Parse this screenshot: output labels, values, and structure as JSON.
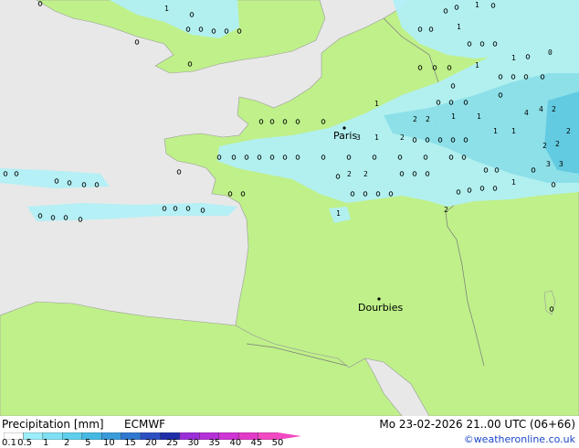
{
  "legend": {
    "title": "Precipitation [mm]",
    "model": "ECMWF",
    "ticks": [
      "0.1",
      "0.5",
      "1",
      "2",
      "5",
      "10",
      "15",
      "20",
      "25",
      "30",
      "35",
      "40",
      "45",
      "50"
    ],
    "colors": [
      "#ffffff",
      "#9beefa",
      "#7fe0f4",
      "#5ecfec",
      "#46b9e3",
      "#3a9bd9",
      "#2f78cf",
      "#2d4fc4",
      "#1f2ea8",
      "#9b2fd8",
      "#b530d8",
      "#cf34d4",
      "#e33ac8",
      "#f24ac2"
    ]
  },
  "datetime": "Mo 23-02-2026 21..00 UTC (06+66)",
  "credit": "©weatheronline.co.uk",
  "cities": [
    {
      "name": "Paris"
    },
    {
      "name": "Dourbies"
    }
  ],
  "map_colors": {
    "sea": "#e8e8e8",
    "land": "#bff08a",
    "precip_light": "#b2f1f6",
    "precip_med": "#8be0ee",
    "precip_strong": "#5ec9e6"
  },
  "precip_values": {
    "paris_band": [
      "0",
      "0",
      "0",
      "0",
      "0",
      "1",
      "0",
      "1",
      "3",
      "1",
      "2",
      "1",
      "0",
      "1",
      "1",
      "2",
      "1",
      "1",
      "0"
    ],
    "channel_row": [
      "0",
      "0",
      "0",
      "0",
      "0",
      "0",
      "0",
      "1",
      "0",
      "0",
      "0",
      "0",
      "0",
      "1",
      "0",
      "0",
      "0",
      "0",
      "1",
      "0"
    ],
    "east_block": [
      "1",
      "1",
      "1",
      "0",
      "1",
      "1",
      "0",
      "1",
      "1",
      "1",
      "4",
      "4",
      "2",
      "2",
      "2",
      "2",
      "3",
      "3",
      "2",
      "1",
      "2"
    ],
    "west_atlantic": [
      "0",
      "0",
      "0",
      "0",
      "0",
      "0",
      "0",
      "0"
    ],
    "britain": [
      "0",
      "1",
      "0",
      "0",
      "0",
      "0",
      "0",
      "0",
      "0"
    ],
    "south_row": [
      "0",
      "2",
      "1",
      "1",
      "0",
      "0",
      "0",
      "0",
      "0"
    ],
    "misc": [
      "1",
      "2",
      "0",
      "0"
    ]
  }
}
